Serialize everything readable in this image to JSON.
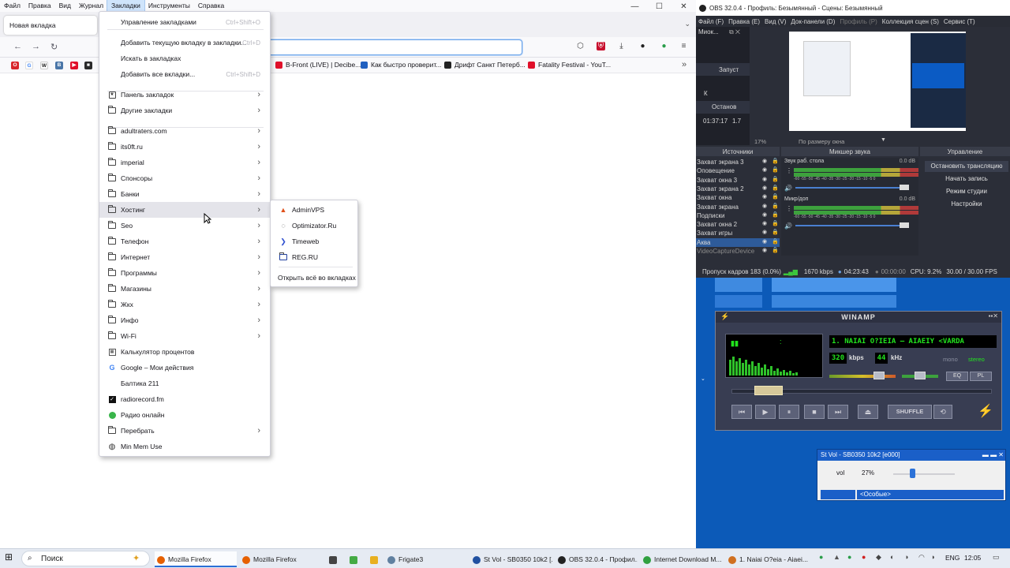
{
  "firefox": {
    "menubar": [
      "Файл",
      "Правка",
      "Вид",
      "Журнал",
      "Закладки",
      "Инструменты",
      "Справка"
    ],
    "tab_title": "Новая вкладка",
    "bookmarks_bar": [
      {
        "label": "B-Front (LIVE) | Decibe...",
        "color": "#e0102a"
      },
      {
        "label": "Как быстро проверит...",
        "color": "#2060c0"
      },
      {
        "label": "Дрифт Санкт Петерб...",
        "color": "#222222"
      },
      {
        "label": "Fatality Festival - YouT...",
        "color": "#e0102a"
      }
    ]
  },
  "bookmarks_menu": {
    "top": [
      {
        "label": "Управление закладками",
        "shortcut": "Ctrl+Shift+O"
      },
      {
        "label": "Добавить текущую вкладку в закладки...",
        "shortcut": "Ctrl+D"
      },
      {
        "label": "Искать в закладках",
        "shortcut": ""
      },
      {
        "label": "Добавить все вкладки...",
        "shortcut": "Ctrl+Shift+D"
      }
    ],
    "toolbar_items": [
      {
        "label": "Панель закладок",
        "icon": "bookmarks-toolbar-icon"
      },
      {
        "label": "Другие закладки",
        "icon": "folder-icon"
      }
    ],
    "folders": [
      "adultraters.com",
      "its0ft.ru",
      "imperial",
      "Спонсоры",
      "Банки",
      "Хостинг",
      "Seo",
      "Телефон",
      "Интернет",
      "Программы",
      "Магазины",
      "Жкх",
      "Инфо",
      "Wi-Fi"
    ],
    "links": [
      {
        "label": "Калькулятор процентов",
        "icon": "calculator-icon",
        "arrow": false
      },
      {
        "label": "Google – Мои действия",
        "icon": "google-icon",
        "arrow": false
      },
      {
        "label": "Балтика 211",
        "icon": "",
        "arrow": false
      },
      {
        "label": "radiorecord.fm",
        "icon": "radiorecord-icon",
        "arrow": false
      },
      {
        "label": "Радио онлайн",
        "icon": "radio-icon",
        "arrow": false
      },
      {
        "label": "Перебрать",
        "icon": "folder-icon",
        "arrow": true
      },
      {
        "label": "Min Mem Use",
        "icon": "globe-icon",
        "arrow": false
      }
    ]
  },
  "hosting_submenu": {
    "items": [
      {
        "label": "AdminVPS",
        "icon": "adminvps-icon",
        "color": "#e0501a"
      },
      {
        "label": "Optimizator.Ru",
        "icon": "optimizator-icon",
        "color": "#333333"
      },
      {
        "label": "Timeweb",
        "icon": "timeweb-icon",
        "color": "#3050d0"
      },
      {
        "label": "REG.RU",
        "icon": "folder-icon",
        "color": "#2040a0"
      }
    ],
    "open_all": "Открыть всё во вкладках"
  },
  "obs": {
    "title": "OBS 32.0.4 - Профиль: Безымянный - Сцены: Безымянный",
    "menubar": [
      "Файл (F)",
      "Правка (E)",
      "Вид (V)",
      "Док-панели (D)",
      "Профиль (P)",
      "Коллекция сцен (S)",
      "Сервис (T)"
    ],
    "left_panel": [
      "Миок...",
      "Запуст",
      "К",
      "Останов",
      "01:37:17",
      "1.7"
    ],
    "zoom": "17%",
    "zoom_mode": "По размеру окна",
    "headers": {
      "sources": "Источники",
      "mixer": "Микшер звука",
      "controls": "Управление"
    },
    "sources": [
      "Захват экрана 3",
      "Оповещение",
      "Захват окна 3",
      "Захват экрана 2",
      "Захват окна",
      "Захват экрана",
      "Подписки",
      "Захват окна 2",
      "Захват игры",
      "Аква",
      "VideoCaptureDevice"
    ],
    "mixer": [
      {
        "name": "Звук раб. стола",
        "db": "0.0 dB"
      },
      {
        "name": "Микр/доп",
        "db": "0.0 dB"
      }
    ],
    "mixer_scale": "-60 -55 -50 -45 -40 -35 -30 -25 -20 -15 -10 -5 0",
    "controls": [
      "Остановить трансляцию",
      "Начать запись",
      "Режим студии",
      "Настройки"
    ],
    "status": {
      "dropped": "Пропуск кадров 183 (0.0%)",
      "bitrate": "1670 kbps",
      "live_time": "04:23:43",
      "rec_time": "00:00:00",
      "cpu": "CPU: 9.2%",
      "fps": "30.00 / 30.00 FPS"
    }
  },
  "winamp": {
    "title": "WINAMP",
    "song": "1. NAIAI O?IEIA – AIAEIY <VARDA",
    "kbps": "320",
    "kbps_label": "kbps",
    "khz": "44",
    "khz_label": "kHz",
    "mono": "mono",
    "stereo": "stereo",
    "eq": "EQ",
    "pl": "PL",
    "shuffle": "SHUFFLE",
    "position": 0.1,
    "volume": 0.8
  },
  "volume_window": {
    "title": "St Vol - SB0350 10k2 [e000]",
    "vol_label": "vol",
    "vol_value": "27%",
    "vol_fraction": 0.27,
    "preset": "<Особые>"
  },
  "taskbar": {
    "search": "Поиск",
    "items": [
      {
        "label": "Mozilla Firefox",
        "color": "#e66000",
        "active": true
      },
      {
        "label": "Mozilla Firefox",
        "color": "#e66000",
        "active": false
      },
      {
        "label": "",
        "color": "#444444",
        "active": false
      },
      {
        "label": "",
        "color": "#44aa44",
        "active": false
      },
      {
        "label": "",
        "color": "#e8b020",
        "active": false
      },
      {
        "label": "Frigate3",
        "color": "#6080a0",
        "active": false
      },
      {
        "label": "St Vol - SB0350 10k2 [...",
        "color": "#2050a0",
        "active": false
      },
      {
        "label": "OBS 32.0.4 - Профил...",
        "color": "#222222",
        "active": false
      },
      {
        "label": "Internet Download M...",
        "color": "#30a040",
        "active": false
      },
      {
        "label": "1. Naiai O?eia - Aiaei...",
        "color": "#d07020",
        "active": false
      }
    ],
    "lang": "ENG",
    "time": "12:05"
  }
}
